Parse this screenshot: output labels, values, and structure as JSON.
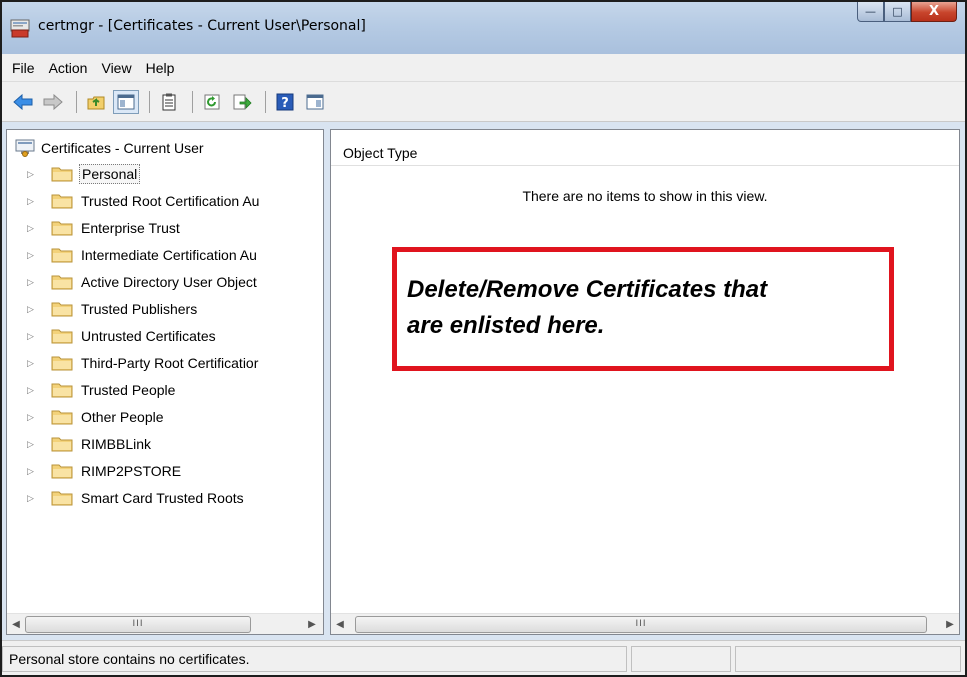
{
  "window": {
    "title": "certmgr - [Certificates - Current User\\Personal]",
    "accent_color": "#b6cbe4",
    "caption_buttons": {
      "minimize": "—",
      "maximize": "□",
      "close": "X"
    }
  },
  "menu": [
    "File",
    "Action",
    "View",
    "Help"
  ],
  "toolbar": {
    "icons": [
      "back-arrow-icon",
      "forward-arrow-icon",
      "up-folder-icon",
      "show-hide-tree-icon",
      "properties-icon",
      "refresh-icon",
      "export-list-icon",
      "help-icon",
      "show-hide-action-pane-icon"
    ]
  },
  "tree": {
    "root": "Certificates - Current User",
    "items": [
      {
        "label": "Personal",
        "selected": true
      },
      {
        "label": "Trusted Root Certification Au"
      },
      {
        "label": "Enterprise Trust"
      },
      {
        "label": "Intermediate Certification Au"
      },
      {
        "label": "Active Directory User Object"
      },
      {
        "label": "Trusted Publishers"
      },
      {
        "label": "Untrusted Certificates"
      },
      {
        "label": "Third-Party Root Certificatior"
      },
      {
        "label": "Trusted People"
      },
      {
        "label": "Other People"
      },
      {
        "label": "RIMBBLink"
      },
      {
        "label": "RIMP2PSTORE"
      },
      {
        "label": "Smart Card Trusted Roots"
      }
    ]
  },
  "list": {
    "column_header": "Object Type",
    "empty_message": "There are no items to show in this view."
  },
  "annotation": {
    "line1": "Delete/Remove Certificates that",
    "line2": "are enlisted here.",
    "border_color": "#e0141e"
  },
  "scrollbar": {
    "grip": "III"
  },
  "status": {
    "text": "Personal store contains no certificates."
  }
}
